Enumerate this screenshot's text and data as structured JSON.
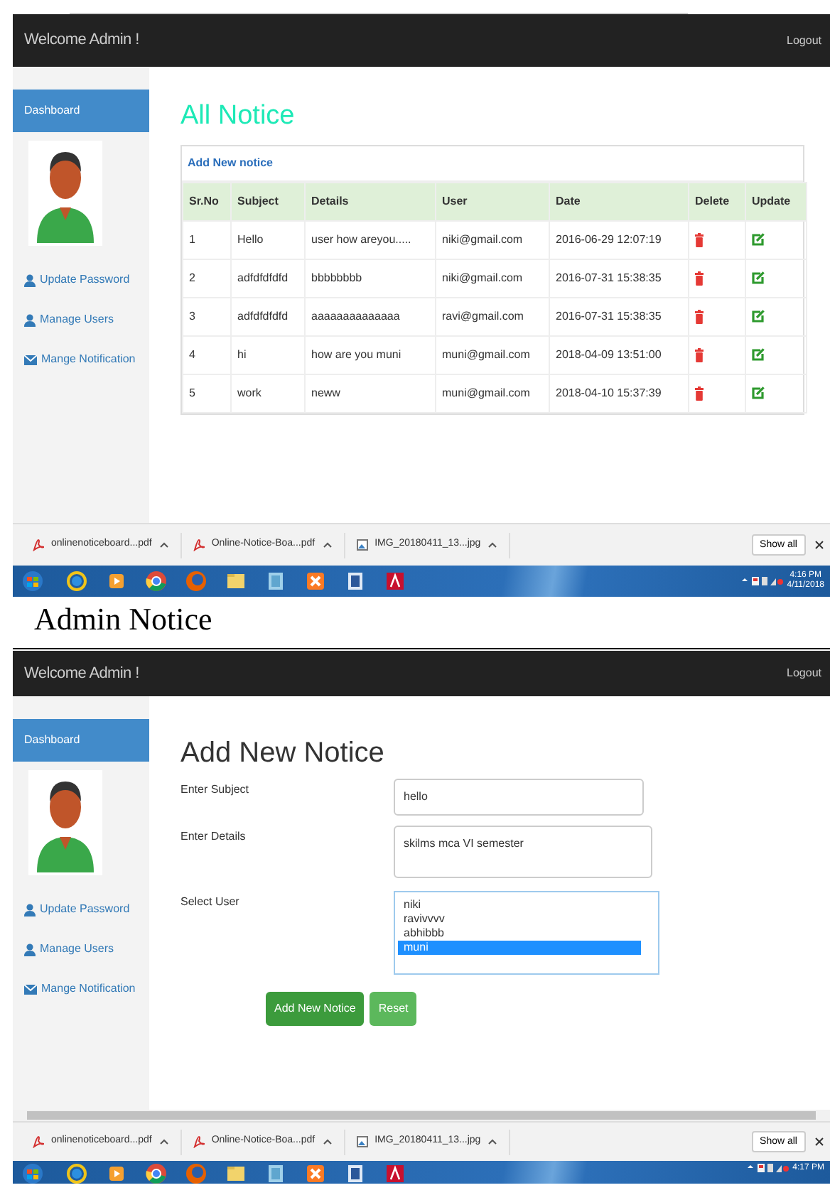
{
  "screens": [
    {
      "navbar": {
        "title": "Welcome Admin !",
        "logout": "Logout"
      },
      "sidebar": [
        {
          "label": "Dashboard",
          "kind": "tab",
          "selected": true
        },
        {
          "kind": "avatar"
        },
        {
          "label": "Update Password",
          "kind": "account",
          "selected": false
        },
        {
          "label": "Manage Users",
          "kind": "account",
          "selected": false
        },
        {
          "label": "Mange Notification",
          "kind": "message",
          "selected": false
        }
      ],
      "content": {
        "kind": "table",
        "title": "All Notice",
        "panel_link": "Add New notice",
        "columns": [
          "Sr.No",
          "Subject",
          "Details",
          "User",
          "Date",
          "Delete",
          "Update"
        ],
        "rows": [
          [
            "1",
            "Hello",
            "user how areyou.....",
            "niki@gmail.com",
            "2016-06-29 12:07:19"
          ],
          [
            "2",
            "adfdfdfdfd",
            "bbbbbbbb",
            "niki@gmail.com",
            "2016-07-31 15:38:35"
          ],
          [
            "3",
            "adfdfdfdfd",
            "aaaaaaaaaaaaaa",
            "ravi@gmail.com",
            "2016-07-31 15:38:35"
          ],
          [
            "4",
            "hi",
            "how are you muni",
            "muni@gmail.com",
            "2018-04-09 13:51:00"
          ],
          [
            "5",
            "work",
            "neww",
            "muni@gmail.com",
            "2018-04-10 15:37:39"
          ]
        ]
      },
      "downloads": [
        {
          "name": "onlinenoticeboard...pdf",
          "kind": "pdf"
        },
        {
          "name": "Online-Notice-Boa...pdf",
          "kind": "pdf"
        },
        {
          "name": "IMG_20180411_13...jpg",
          "kind": "image"
        }
      ],
      "show_all": "Show all",
      "clock": {
        "time": "4:16 PM",
        "date": "4/11/2018"
      }
    },
    {
      "navbar": {
        "title": "Welcome Admin !",
        "logout": "Logout"
      },
      "sidebar": [
        {
          "label": "Dashboard",
          "kind": "tab",
          "selected": true
        },
        {
          "kind": "avatar"
        },
        {
          "label": "Update Password",
          "kind": "account",
          "selected": false
        },
        {
          "label": "Manage Users",
          "kind": "account",
          "selected": false
        },
        {
          "label": "Mange Notification",
          "kind": "message",
          "selected": false
        }
      ],
      "content": {
        "kind": "form",
        "title": "Add New Notice",
        "fields": [
          {
            "label": "Enter Subject",
            "kind": "input",
            "value": "hello"
          },
          {
            "label": "Enter Details",
            "kind": "textarea",
            "value": "skilms mca VI semester"
          },
          {
            "label": "Select User",
            "kind": "listbox",
            "options": [
              {
                "label": "niki",
                "selected": false
              },
              {
                "label": "ravivvvv",
                "selected": false
              },
              {
                "label": "abhibbb",
                "selected": false
              },
              {
                "label": "muni",
                "selected": true
              }
            ]
          }
        ],
        "buttons": [
          {
            "label": "Add New Notice",
            "kind": "primary"
          },
          {
            "label": "Reset",
            "kind": "secondary"
          }
        ]
      },
      "scrollbar": true,
      "downloads": [
        {
          "name": "onlinenoticeboard...pdf",
          "kind": "pdf"
        },
        {
          "name": "Online-Notice-Boa...pdf",
          "kind": "pdf"
        },
        {
          "name": "IMG_20180411_13...jpg",
          "kind": "image"
        }
      ],
      "show_all": "Show all",
      "clock": {
        "time": "4:17 PM"
      }
    }
  ],
  "caption": "Admin Notice"
}
